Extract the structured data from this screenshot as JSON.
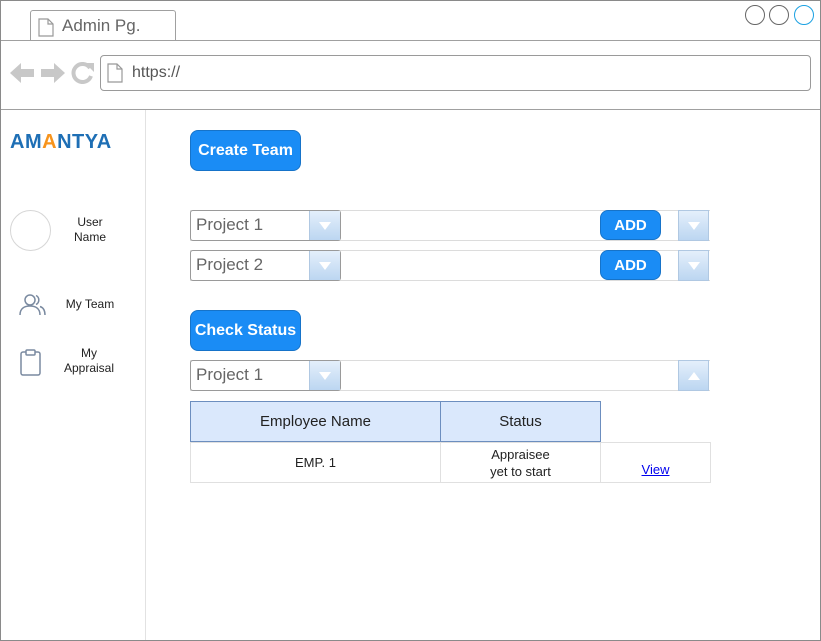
{
  "browser": {
    "tab_title": "Admin Pg.",
    "url": "https://"
  },
  "sidebar": {
    "logo_prefix": "AM",
    "logo_accent": "A",
    "logo_suffix": "NTYA",
    "user_line1": "User",
    "user_line2": "Name",
    "items": [
      {
        "label": "My Team",
        "icon": "team-icon"
      },
      {
        "label_line1": "My",
        "label_line2": "Appraisal",
        "icon": "clipboard-icon"
      }
    ]
  },
  "main": {
    "create_team_label": "Create Team",
    "project_rows": [
      {
        "project": "Project 1",
        "add_label": "ADD"
      },
      {
        "project": "Project 2",
        "add_label": "ADD"
      }
    ],
    "check_status_label": "Check Status",
    "status_project": "Project 1",
    "table": {
      "headers": [
        "Employee Name",
        "Status"
      ],
      "rows": [
        {
          "employee": "EMP. 1",
          "status_line1": "Appraisee",
          "status_line2": "yet to start",
          "action": "View"
        }
      ]
    }
  },
  "colors": {
    "accent_blue": "#1a8cf5",
    "header_fill": "#dae8fc",
    "logo_blue": "#1e6fb5",
    "logo_orange": "#f7941d"
  }
}
